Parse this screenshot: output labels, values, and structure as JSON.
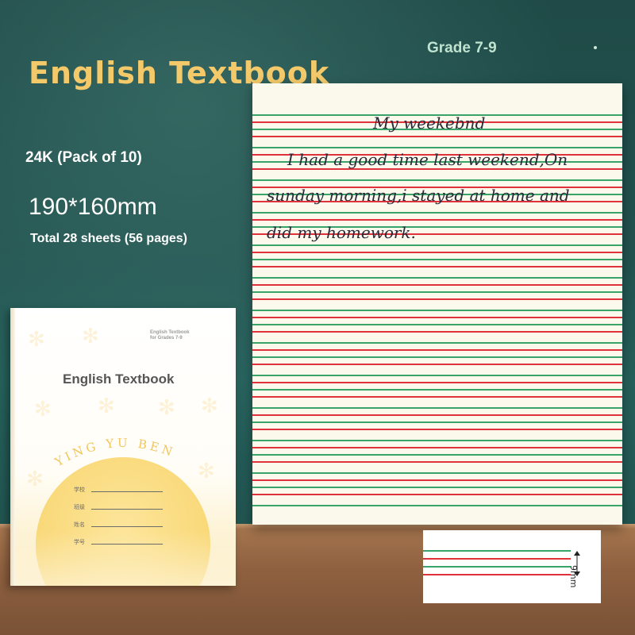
{
  "headline": "English Textbook",
  "grade": "Grade 7-9",
  "pack": "24K (Pack of 10)",
  "size": "190*160mm",
  "sheets": "Total 28 sheets (56 pages)",
  "notebook_page": {
    "title": "My weekebnd",
    "line1": "I had a good time last weekend,On",
    "line2": "sunday morning,i stayed at home and",
    "line3": "did my homework.",
    "colors": {
      "green": "#3aa36a",
      "red": "#e0323a",
      "paper": "#fbf8ec"
    }
  },
  "cover": {
    "small_text_1": "English Textbook",
    "small_text_2": "for Grades 7-9",
    "title": "English Textbook",
    "arc_text": "YING YU BEN",
    "fields": [
      "学校",
      "班级",
      "姓名",
      "学号"
    ]
  },
  "spacing_inset": {
    "label": "9mm"
  },
  "colors": {
    "headline": "#f4c96a",
    "grade": "#bfe3cf",
    "background": "#22524f",
    "table": "#8f6140"
  }
}
